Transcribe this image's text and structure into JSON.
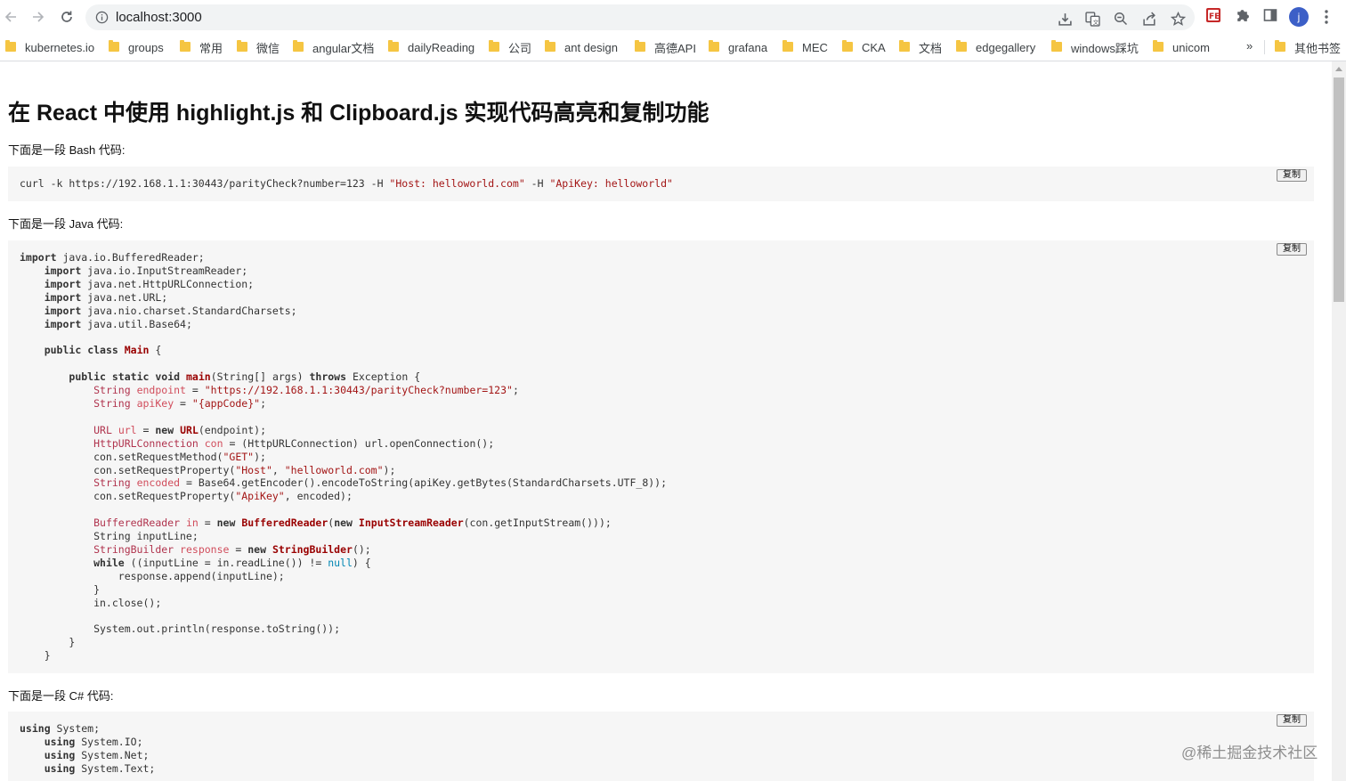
{
  "browser": {
    "url": "localhost:3000",
    "profile_initial": "j",
    "bookmarks": [
      "kubernetes.io",
      "groups",
      "常用",
      "微信",
      "angular文档",
      "dailyReading",
      "公司",
      "ant design",
      "高德API",
      "grafana",
      "MEC",
      "CKA",
      "文档",
      "edgegallery",
      "windows踩坑",
      "unicom"
    ],
    "more": "»",
    "other_bookmarks": "其他书签"
  },
  "page": {
    "title": "在 React 中使用 highlight.js 和 Clipboard.js 实现代码高亮和复制功能",
    "bash_intro": "下面是一段 Bash 代码:",
    "java_intro": "下面是一段 Java 代码:",
    "csharp_intro": "下面是一段 C# 代码:",
    "copy_label": "复制"
  },
  "code": {
    "bash": [
      [
        [
          "curl -k https://192.168.1.1:30443/parityCheck?number=123 -H ",
          ""
        ],
        [
          "\"Host: helloworld.com\"",
          "str"
        ],
        [
          " -H ",
          ""
        ],
        [
          "\"ApiKey: helloworld\"",
          "str"
        ]
      ]
    ],
    "java": [
      [
        [
          "import",
          "kw"
        ],
        [
          " java.io.BufferedReader;",
          ""
        ]
      ],
      [
        [
          "    ",
          ""
        ],
        [
          "import",
          "kw"
        ],
        [
          " java.io.InputStreamReader;",
          ""
        ]
      ],
      [
        [
          "    ",
          ""
        ],
        [
          "import",
          "kw"
        ],
        [
          " java.net.HttpURLConnection;",
          ""
        ]
      ],
      [
        [
          "    ",
          ""
        ],
        [
          "import",
          "kw"
        ],
        [
          " java.net.URL;",
          ""
        ]
      ],
      [
        [
          "    ",
          ""
        ],
        [
          "import",
          "kw"
        ],
        [
          " java.nio.charset.StandardCharsets;",
          ""
        ]
      ],
      [
        [
          "    ",
          ""
        ],
        [
          "import",
          "kw"
        ],
        [
          " java.util.Base64;",
          ""
        ]
      ],
      [],
      [
        [
          "    ",
          ""
        ],
        [
          "public",
          "kw"
        ],
        [
          " ",
          ""
        ],
        [
          "class",
          "kw"
        ],
        [
          " ",
          ""
        ],
        [
          "Main",
          "ttl"
        ],
        [
          " {",
          ""
        ]
      ],
      [],
      [
        [
          "        ",
          ""
        ],
        [
          "public",
          "kw"
        ],
        [
          " ",
          ""
        ],
        [
          "static",
          "kw"
        ],
        [
          " ",
          ""
        ],
        [
          "void",
          "kw"
        ],
        [
          " ",
          ""
        ],
        [
          "main",
          "ttl"
        ],
        [
          "(String[] args) ",
          ""
        ],
        [
          "throws",
          "kw"
        ],
        [
          " Exception {",
          ""
        ]
      ],
      [
        [
          "            ",
          ""
        ],
        [
          "String",
          "ty"
        ],
        [
          " ",
          ""
        ],
        [
          "endpoint",
          "var"
        ],
        [
          " = ",
          ""
        ],
        [
          "\"https://192.168.1.1:30443/parityCheck?number=123\"",
          "str"
        ],
        [
          ";",
          ""
        ]
      ],
      [
        [
          "            ",
          ""
        ],
        [
          "String",
          "ty"
        ],
        [
          " ",
          ""
        ],
        [
          "apiKey",
          "var"
        ],
        [
          " = ",
          ""
        ],
        [
          "\"{appCode}\"",
          "str"
        ],
        [
          ";",
          ""
        ]
      ],
      [],
      [
        [
          "            ",
          ""
        ],
        [
          "URL",
          "ty"
        ],
        [
          " ",
          ""
        ],
        [
          "url",
          "var"
        ],
        [
          " = ",
          ""
        ],
        [
          "new",
          "kw"
        ],
        [
          " ",
          ""
        ],
        [
          "URL",
          "ttl"
        ],
        [
          "(endpoint);",
          ""
        ]
      ],
      [
        [
          "            ",
          ""
        ],
        [
          "HttpURLConnection",
          "ty"
        ],
        [
          " ",
          ""
        ],
        [
          "con",
          "var"
        ],
        [
          " = (HttpURLConnection) url.openConnection();",
          ""
        ]
      ],
      [
        [
          "            con.setRequestMethod(",
          ""
        ],
        [
          "\"GET\"",
          "str"
        ],
        [
          ");",
          ""
        ]
      ],
      [
        [
          "            con.setRequestProperty(",
          ""
        ],
        [
          "\"Host\"",
          "str"
        ],
        [
          ", ",
          ""
        ],
        [
          "\"helloworld.com\"",
          "str"
        ],
        [
          ");",
          ""
        ]
      ],
      [
        [
          "            ",
          ""
        ],
        [
          "String",
          "ty"
        ],
        [
          " ",
          ""
        ],
        [
          "encoded",
          "var"
        ],
        [
          " = Base64.getEncoder().encodeToString(apiKey.getBytes(StandardCharsets.UTF_8));",
          ""
        ]
      ],
      [
        [
          "            con.setRequestProperty(",
          ""
        ],
        [
          "\"ApiKey\"",
          "str"
        ],
        [
          ", encoded);",
          ""
        ]
      ],
      [],
      [
        [
          "            ",
          ""
        ],
        [
          "BufferedReader",
          "ty"
        ],
        [
          " ",
          ""
        ],
        [
          "in",
          "var"
        ],
        [
          " = ",
          ""
        ],
        [
          "new",
          "kw"
        ],
        [
          " ",
          ""
        ],
        [
          "BufferedReader",
          "ttl"
        ],
        [
          "(",
          ""
        ],
        [
          "new",
          "kw"
        ],
        [
          " ",
          ""
        ],
        [
          "InputStreamReader",
          "ttl"
        ],
        [
          "(con.getInputStream()));",
          ""
        ]
      ],
      [
        [
          "            String inputLine;",
          ""
        ]
      ],
      [
        [
          "            ",
          ""
        ],
        [
          "StringBuilder",
          "ty"
        ],
        [
          " ",
          ""
        ],
        [
          "response",
          "var"
        ],
        [
          " = ",
          ""
        ],
        [
          "new",
          "kw"
        ],
        [
          " ",
          ""
        ],
        [
          "StringBuilder",
          "ttl"
        ],
        [
          "();",
          ""
        ]
      ],
      [
        [
          "            ",
          ""
        ],
        [
          "while",
          "kw"
        ],
        [
          " ((inputLine = in.readLine()) != ",
          ""
        ],
        [
          "null",
          "lit"
        ],
        [
          ") {",
          ""
        ]
      ],
      [
        [
          "                response.append(inputLine);",
          ""
        ]
      ],
      [
        [
          "            }",
          ""
        ]
      ],
      [
        [
          "            in.close();",
          ""
        ]
      ],
      [],
      [
        [
          "            System.out.println(response.toString());",
          ""
        ]
      ],
      [
        [
          "        }",
          ""
        ]
      ],
      [
        [
          "    }",
          ""
        ]
      ]
    ],
    "csharp": [
      [
        [
          "using",
          "kw"
        ],
        [
          " System;",
          ""
        ]
      ],
      [
        [
          "    ",
          ""
        ],
        [
          "using",
          "kw"
        ],
        [
          " System.IO;",
          ""
        ]
      ],
      [
        [
          "    ",
          ""
        ],
        [
          "using",
          "kw"
        ],
        [
          " System.Net;",
          ""
        ]
      ],
      [
        [
          "    ",
          ""
        ],
        [
          "using",
          "kw"
        ],
        [
          " System.Text;",
          ""
        ]
      ]
    ]
  },
  "watermark": "@稀土掘金技术社区",
  "colors": {
    "code_bg": "#f6f6f6",
    "keyword": "#333333",
    "title": "#990000",
    "type": "#b0334d",
    "string": "#a31515"
  }
}
